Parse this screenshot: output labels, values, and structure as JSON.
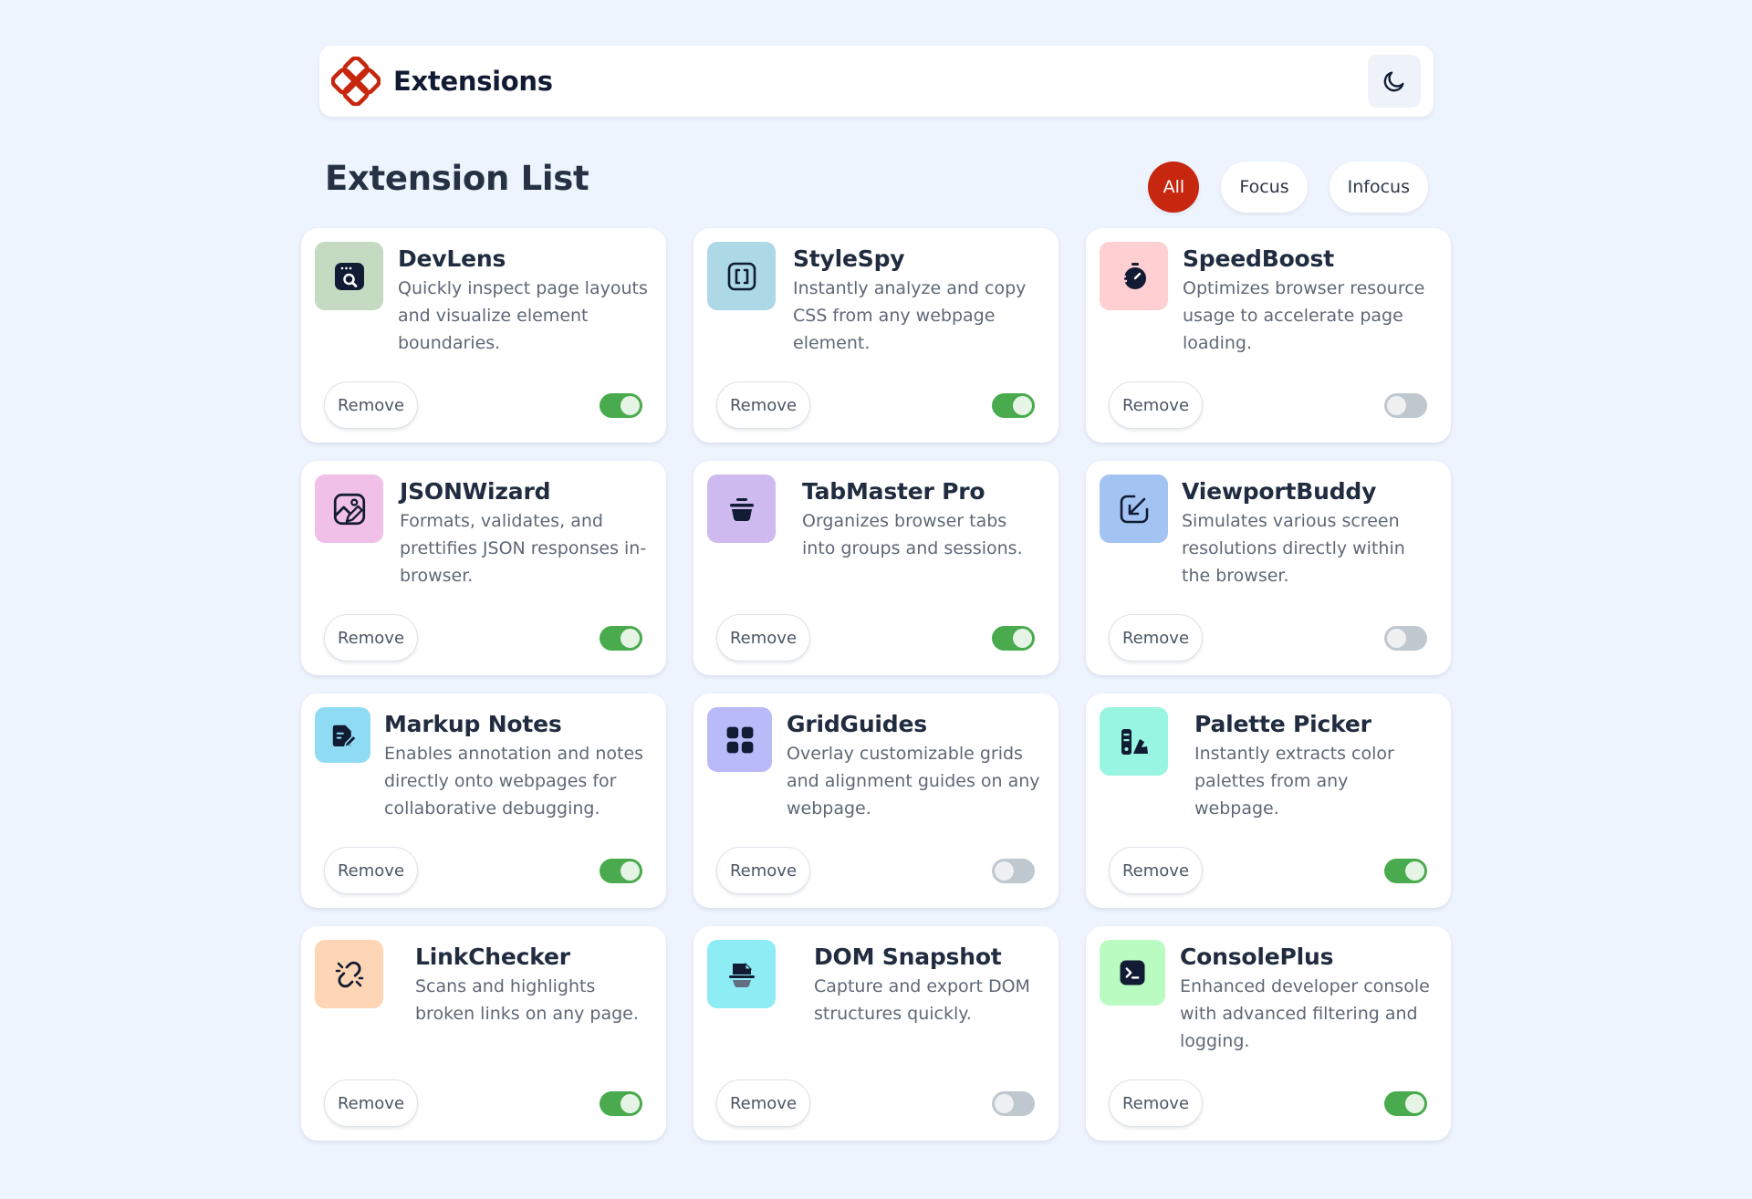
{
  "header": {
    "title": "Extensions",
    "logo_icon": "extensions-logo",
    "logo_color": "#c7270f",
    "theme_toggle_icon": "moon-icon"
  },
  "main": {
    "title": "Extension List",
    "filters": [
      {
        "label": "All",
        "active": true
      },
      {
        "label": "Focus",
        "active": false
      },
      {
        "label": "Infocus",
        "active": false
      }
    ],
    "remove_label": "Remove",
    "extensions": [
      {
        "name": "DevLens",
        "desc": "Quickly inspect page layouts and visualize element boundaries.",
        "icon": "inspect-window-icon",
        "icon_bg": "#c4dbc2",
        "enabled": true
      },
      {
        "name": "StyleSpy",
        "desc": "Instantly analyze and copy CSS from any webpage element.",
        "icon": "brackets-icon",
        "icon_bg": "#add8e6",
        "enabled": true
      },
      {
        "name": "SpeedBoost",
        "desc": "Optimizes browser resource usage to accelerate page loading.",
        "icon": "stopwatch-icon",
        "icon_bg": "#ffcfd2",
        "enabled": false
      },
      {
        "name": "JSONWizard",
        "desc": "Formats, validates, and prettifies JSON responses in-browser.",
        "icon": "edit-image-icon",
        "icon_bg": "#f1c0e8",
        "enabled": true
      },
      {
        "name": "TabMaster Pro",
        "desc": "Organizes browser tabs into groups and sessions.",
        "icon": "bowl-icon",
        "icon_bg": "#cfbaf0",
        "enabled": true
      },
      {
        "name": "ViewportBuddy",
        "desc": "Simulates various screen resolutions directly within the browser.",
        "icon": "resize-arrow-icon",
        "icon_bg": "#a3c4f3",
        "enabled": false
      },
      {
        "name": "Markup Notes",
        "desc": "Enables annotation and notes directly onto webpages for collaborative debugging.",
        "icon": "note-pencil-icon",
        "icon_bg": "#90dbf4",
        "enabled": true
      },
      {
        "name": "GridGuides",
        "desc": "Overlay customizable grids and alignment guides on any webpage.",
        "icon": "grid-icon",
        "icon_bg": "#b9bbf9",
        "enabled": false
      },
      {
        "name": "Palette Picker",
        "desc": "Instantly extracts color palettes from any webpage.",
        "icon": "palette-icon",
        "icon_bg": "#98f5e1",
        "enabled": true
      },
      {
        "name": "LinkChecker",
        "desc": "Scans and highlights broken links on any page.",
        "icon": "broken-link-icon",
        "icon_bg": "#ffd6b5",
        "enabled": true
      },
      {
        "name": "DOM Snapshot",
        "desc": "Capture and export DOM structures quickly.",
        "icon": "snapshot-icon",
        "icon_bg": "#8eecf5",
        "enabled": false
      },
      {
        "name": "ConsolePlus",
        "desc": "Enhanced developer console with advanced filtering and logging.",
        "icon": "terminal-icon",
        "icon_bg": "#b9fbc0",
        "enabled": true
      }
    ]
  }
}
